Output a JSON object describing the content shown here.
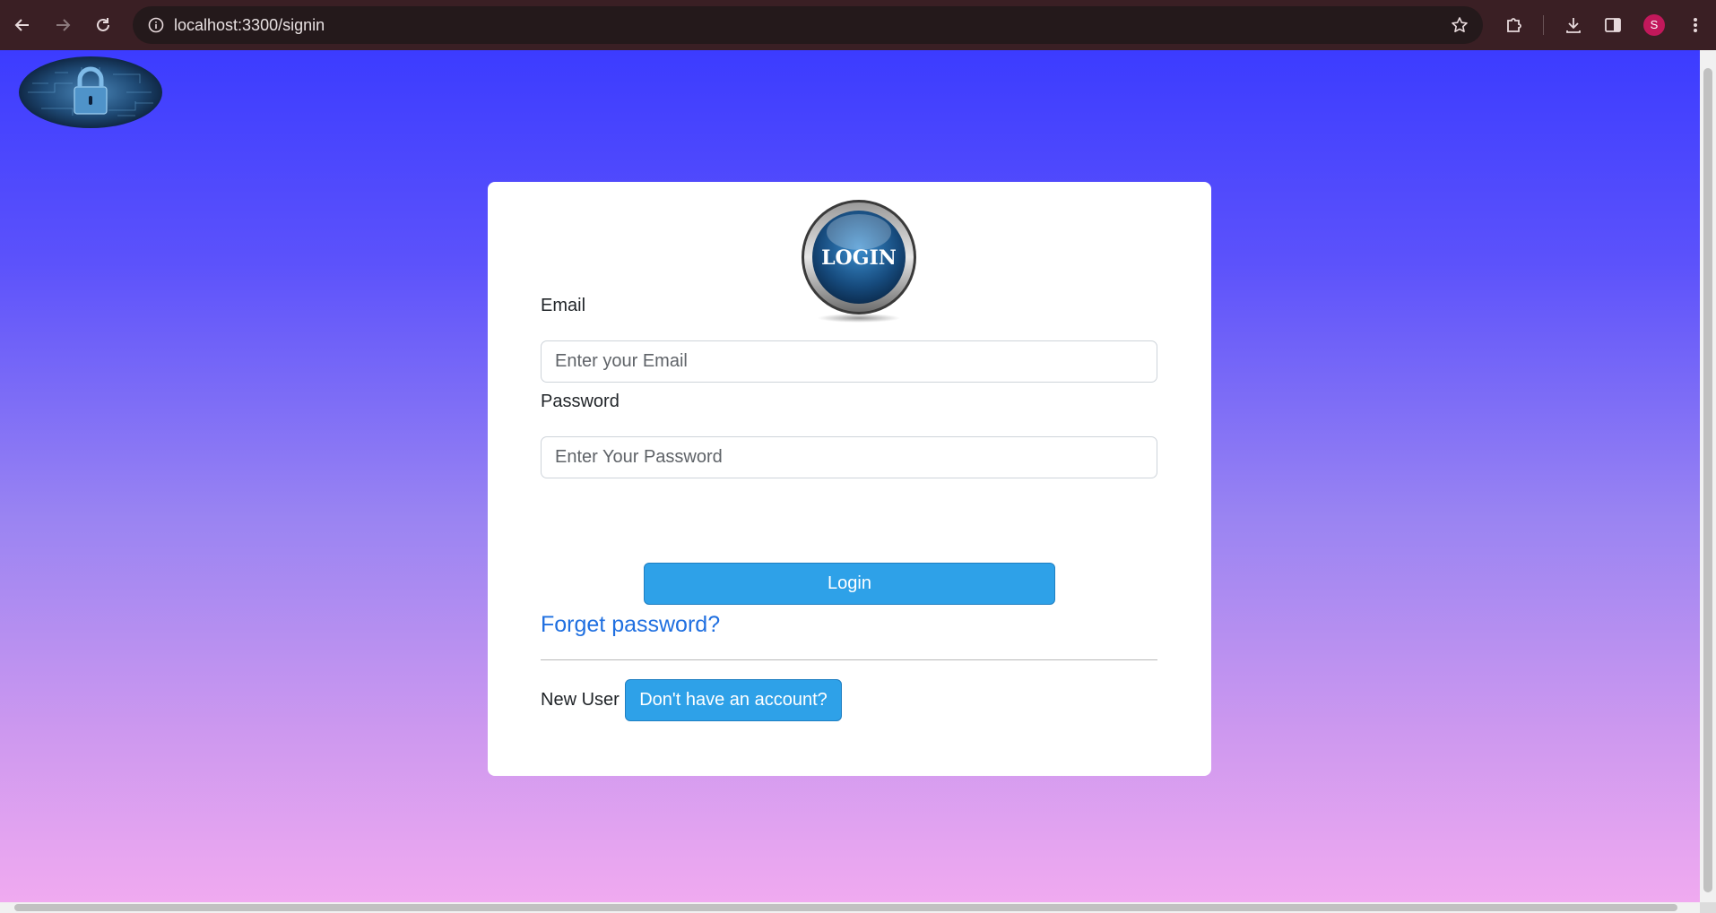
{
  "browser": {
    "url": "localhost:3300/signin",
    "profile_initial": "S",
    "icons": {
      "back": "arrow-left-icon",
      "forward": "arrow-right-icon",
      "reload": "reload-icon",
      "site_info": "info-icon",
      "bookmark": "star-icon",
      "extensions": "puzzle-icon",
      "downloads": "download-icon",
      "side_panel": "side-panel-icon",
      "menu": "kebab-menu-icon"
    }
  },
  "page": {
    "logo_alt": "lock-on-circuit-logo",
    "login_badge_text": "LOGIN",
    "form": {
      "email_label": "Email",
      "email_placeholder": "Enter your Email",
      "password_label": "Password",
      "password_placeholder": "Enter Your Password",
      "login_button": "Login",
      "forgot_link": "Forget password?",
      "new_user_text": "New User",
      "signup_button": "Don't have an account?"
    }
  },
  "colors": {
    "gradient_top": "#3c3cff",
    "gradient_bottom": "#f0aaf0",
    "button": "#2ea1e8",
    "link": "#1f6fe0",
    "chrome": "#3a1f24",
    "avatar": "#c2185b"
  }
}
